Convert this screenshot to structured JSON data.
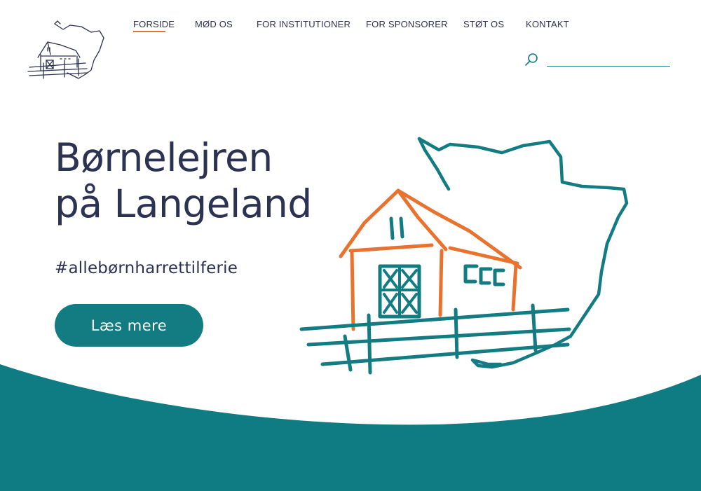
{
  "colors": {
    "navy": "#2c3252",
    "teal": "#137c83",
    "orange": "#e9722f",
    "white": "#ffffff"
  },
  "header": {
    "logo_icon": "farmhouse-langeland-logo"
  },
  "nav": {
    "items": [
      {
        "label": "FORSIDE",
        "active": true
      },
      {
        "label": "MØD OS",
        "active": false
      },
      {
        "label": "FOR INSTITUTIONER",
        "active": false
      },
      {
        "label": "FOR SPONSORER",
        "active": false
      },
      {
        "label": "STØT OS",
        "active": false
      },
      {
        "label": "KONTAKT",
        "active": false
      }
    ]
  },
  "search": {
    "icon": "search-icon",
    "placeholder": "",
    "value": ""
  },
  "hero": {
    "title_line1": "Børnelejren",
    "title_line2": "på Langeland",
    "hashtag": "#allebørnharrettilferie",
    "cta_label": "Læs mere",
    "illustration_icon": "house-on-island-illustration"
  }
}
